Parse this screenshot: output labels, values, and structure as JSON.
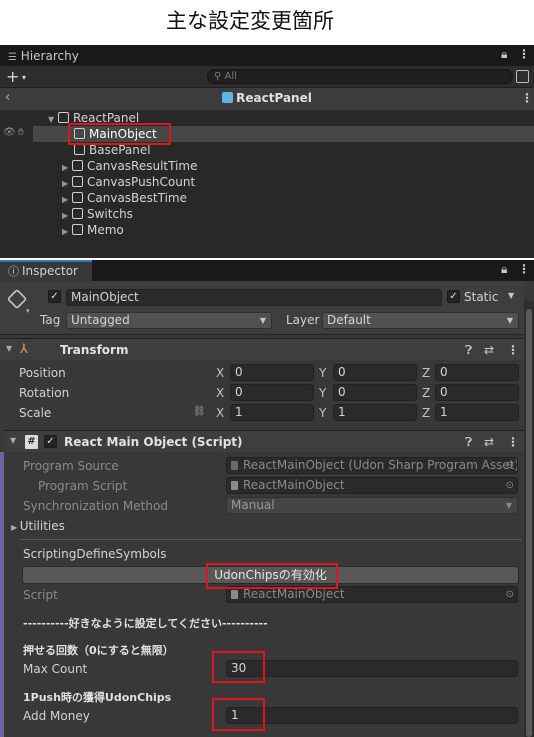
{
  "page_title": "主な設定変更箇所",
  "hierarchy": {
    "tab_label": "Hierarchy",
    "search_placeholder": "All",
    "scene_name": "ReactPanel",
    "items": [
      {
        "label": "ReactPanel",
        "expanded": true
      },
      {
        "label": "MainObject",
        "selected": true
      },
      {
        "label": "BasePanel"
      },
      {
        "label": "CanvasResultTime",
        "expandable": true
      },
      {
        "label": "CanvasPushCount",
        "expandable": true
      },
      {
        "label": "CanvasBestTime",
        "expandable": true
      },
      {
        "label": "Switchs",
        "expandable": true
      },
      {
        "label": "Memo",
        "expandable": true
      }
    ]
  },
  "inspector": {
    "tab_label": "Inspector",
    "object_name": "MainObject",
    "static_label": "Static",
    "tag_label": "Tag",
    "tag_value": "Untagged",
    "layer_label": "Layer",
    "layer_value": "Default",
    "transform": {
      "title": "Transform",
      "rows": [
        {
          "label": "Position",
          "x": "0",
          "y": "0",
          "z": "0"
        },
        {
          "label": "Rotation",
          "x": "0",
          "y": "0",
          "z": "0"
        },
        {
          "label": "Scale",
          "x": "1",
          "y": "1",
          "z": "1"
        }
      ],
      "axis_x": "X",
      "axis_y": "Y",
      "axis_z": "Z"
    },
    "script_component": {
      "title": "React Main Object (Script)",
      "program_source_label": "Program Source",
      "program_source_value": "ReactMainObject (Udon Sharp Program Asset)",
      "program_script_label": "Program Script",
      "program_script_value": "ReactMainObject",
      "sync_method_label": "Synchronization Method",
      "sync_method_value": "Manual",
      "utilities_label": "Utilities",
      "define_symbols_label": "ScriptingDefineSymbols",
      "udonchips_button": "UdonChipsの有効化",
      "script_label": "Script",
      "script_value": "ReactMainObject",
      "free_setting_header": "----------好きなように設定してください----------",
      "push_count_header": "押せる回数（0にすると無限）",
      "max_count_label": "Max Count",
      "max_count_value": "30",
      "chips_header": "1Push時の獲得UdonChips",
      "add_money_label": "Add Money",
      "add_money_value": "1"
    }
  },
  "colors": {
    "highlight_red": "#e0141e",
    "selection_blue": "#3a79bb",
    "scene_icon": "#5fb4e6"
  }
}
